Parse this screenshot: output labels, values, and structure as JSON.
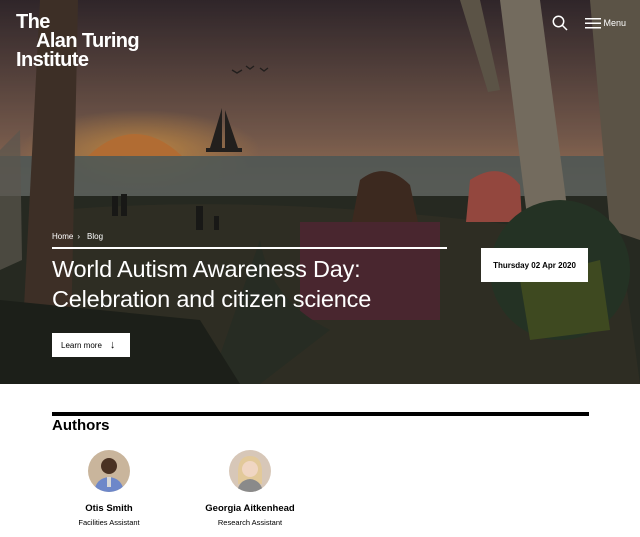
{
  "brand": {
    "line1": "The",
    "line2": "Alan Turing",
    "line3": "Institute"
  },
  "header": {
    "menu_label": "Menu"
  },
  "icons": {
    "search": "search-icon",
    "menu": "hamburger-icon",
    "arrow": "arrow-down-icon",
    "chevron": "chevron-right-icon"
  },
  "breadcrumb": {
    "home": "Home",
    "current": "Blog"
  },
  "hero": {
    "title_line1": "World Autism Awareness Day:",
    "title_line2": "Celebration and citizen science",
    "cta_label": "Learn more",
    "date": "Thursday 02 Apr 2020"
  },
  "authors": {
    "heading": "Authors",
    "items": [
      {
        "name": "Otis Smith",
        "role": "Facilities Assistant"
      },
      {
        "name": "Georgia Aitkenhead",
        "role": "Research Assistant"
      }
    ]
  },
  "colors": {
    "accent": "#ffffff",
    "rule": "#000000"
  }
}
